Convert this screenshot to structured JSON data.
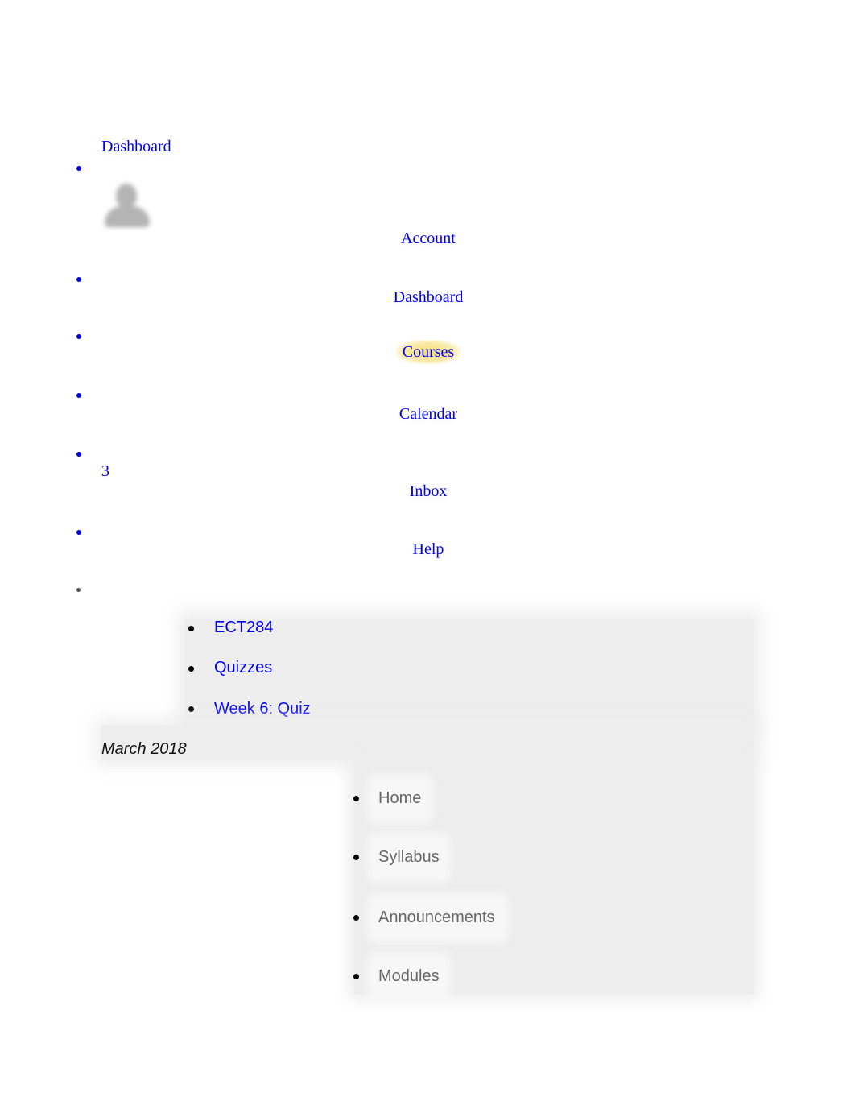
{
  "global_nav": {
    "logo_link": "Dashboard",
    "items": [
      {
        "label": "Account",
        "icon": "avatar-icon"
      },
      {
        "label": "Dashboard"
      },
      {
        "label": "Courses",
        "highlighted": true
      },
      {
        "label": "Calendar"
      },
      {
        "label": "Inbox",
        "badge": "3"
      },
      {
        "label": "Help"
      }
    ]
  },
  "breadcrumbs": [
    "ECT284",
    "Quizzes",
    "Week 6: Quiz"
  ],
  "term_label": "March 2018",
  "course_nav": {
    "items": [
      "Home",
      "Syllabus",
      "Announcements",
      "Modules"
    ]
  },
  "colors": {
    "link": "#0000ee",
    "highlight": "#f5d75a",
    "panel": "#ededed",
    "course_nav_text": "#666666"
  }
}
